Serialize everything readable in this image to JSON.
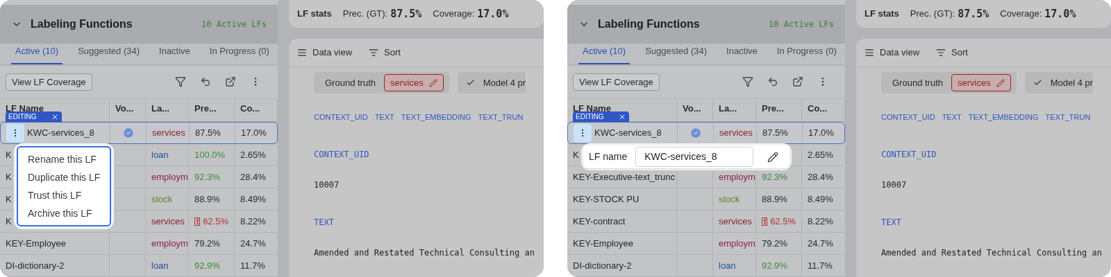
{
  "screens": [
    {
      "lf_panel": {
        "title": "Labeling Functions",
        "count": "10 Active LFs",
        "tabs": [
          {
            "label": "Active (10)",
            "selected": true
          },
          {
            "label": "Suggested (34)",
            "selected": false
          },
          {
            "label": "Inactive",
            "selected": false
          },
          {
            "label": "In Progress (0)",
            "selected": false
          }
        ],
        "coverage_button": "View LF Coverage",
        "columns": [
          "LF Name",
          "Vo...",
          "La...",
          "Pre...",
          "Co..."
        ],
        "editing_badge": "EDITING",
        "rows": [
          {
            "name": "KWC-services_8",
            "selected": true,
            "voted": true,
            "label": "services",
            "color": "#8b1f2e",
            "precision": {
              "text": "87.5%",
              "color": "#2a2a2a"
            },
            "warning": false,
            "coverage": "17.0%"
          },
          {
            "name": "K",
            "selected": false,
            "voted": false,
            "label": "loan",
            "color": "#22509a",
            "precision": {
              "text": "100.0%",
              "color": "#3c8a3c"
            },
            "warning": false,
            "coverage": "2.65%"
          },
          {
            "name": "K",
            "selected": false,
            "voted": false,
            "label": "employm",
            "color": "#8a2148",
            "precision": {
              "text": "92.3%",
              "color": "#3c8a3c"
            },
            "warning": false,
            "coverage": "28.4%"
          },
          {
            "name": "K",
            "selected": false,
            "voted": false,
            "label": "stock",
            "color": "#6f7a2c",
            "precision": {
              "text": "88.9%",
              "color": "#2a2a2a"
            },
            "warning": false,
            "coverage": "8.49%"
          },
          {
            "name": "K",
            "selected": false,
            "voted": false,
            "label": "services",
            "color": "#8b1f2e",
            "precision": {
              "text": "62.5%",
              "color": "#b3312f"
            },
            "warning": true,
            "coverage": "8.22%"
          },
          {
            "name": "KEY-Employee",
            "selected": false,
            "voted": false,
            "label": "employm",
            "color": "#8a2148",
            "precision": {
              "text": "79.2%",
              "color": "#2a2a2a"
            },
            "warning": false,
            "coverage": "24.7%"
          },
          {
            "name": "DI-dictionary-2",
            "selected": false,
            "voted": false,
            "label": "loan",
            "color": "#22509a",
            "precision": {
              "text": "92.9%",
              "color": "#3c8a3c"
            },
            "warning": false,
            "coverage": "11.7%"
          }
        ],
        "overlay": {
          "kind": "menu",
          "items": [
            "Rename this LF",
            "Duplicate this LF",
            "Trust this LF",
            "Archive this LF"
          ]
        }
      },
      "stats": {
        "title": "LF stats",
        "precision_label": "Prec. (GT):",
        "precision": "87.5%",
        "coverage_label": "Coverage:",
        "coverage": "17.0%"
      },
      "data_view": {
        "view_label": "Data view",
        "sort_label": "Sort",
        "ground_truth_label": "Ground truth",
        "ground_truth_value": "services",
        "model_chip": "Model 4 pr",
        "column_tabs": [
          "CONTEXT_UID",
          "TEXT",
          "TEXT_EMBEDDING",
          "TEXT_TRUN"
        ],
        "fields": [
          {
            "name": "CONTEXT_UID",
            "value": "10007"
          },
          {
            "name": "TEXT",
            "value": "Amended and Restated Technical Consulting an"
          }
        ]
      }
    },
    {
      "lf_panel": {
        "title": "Labeling Functions",
        "count": "10 Active LFs",
        "tabs": [
          {
            "label": "Active (10)",
            "selected": true
          },
          {
            "label": "Suggested (34)",
            "selected": false
          },
          {
            "label": "Inactive",
            "selected": false
          },
          {
            "label": "In Progress (0)",
            "selected": false
          }
        ],
        "coverage_button": "View LF Coverage",
        "columns": [
          "LF Name",
          "Vo...",
          "La...",
          "Pre...",
          "Co..."
        ],
        "editing_badge": "EDITING",
        "rows": [
          {
            "name": "KWC-services_8",
            "selected": true,
            "voted": true,
            "label": "services",
            "color": "#8b1f2e",
            "precision": {
              "text": "87.5%",
              "color": "#2a2a2a"
            },
            "warning": false,
            "coverage": "17.0%"
          },
          {
            "name": "K",
            "selected": false,
            "voted": false,
            "warning": false,
            "coverage": "2.65%"
          },
          {
            "name": "KEY-Executive-text_trunc",
            "selected": false,
            "voted": false,
            "label": "employm",
            "color": "#8a2148",
            "precision": {
              "text": "92.3%",
              "color": "#3c8a3c"
            },
            "warning": false,
            "coverage": "28.4%"
          },
          {
            "name": "KEY-STOCK PU",
            "selected": false,
            "voted": false,
            "label": "stock",
            "color": "#6f7a2c",
            "precision": {
              "text": "88.9%",
              "color": "#2a2a2a"
            },
            "warning": false,
            "coverage": "8.49%"
          },
          {
            "name": "KEY-contract",
            "selected": false,
            "voted": false,
            "label": "services",
            "color": "#8b1f2e",
            "precision": {
              "text": "62.5%",
              "color": "#b3312f"
            },
            "warning": true,
            "coverage": "8.22%"
          },
          {
            "name": "KEY-Employee",
            "selected": false,
            "voted": false,
            "label": "employm",
            "color": "#8a2148",
            "precision": {
              "text": "79.2%",
              "color": "#2a2a2a"
            },
            "warning": false,
            "coverage": "24.7%"
          },
          {
            "name": "DI-dictionary-2",
            "selected": false,
            "voted": false,
            "label": "loan",
            "color": "#22509a",
            "precision": {
              "text": "92.9%",
              "color": "#3c8a3c"
            },
            "warning": false,
            "coverage": "11.7%"
          }
        ],
        "overlay": {
          "kind": "rename",
          "label": "LF name",
          "value": "KWC-services_8"
        }
      },
      "stats": {
        "title": "LF stats",
        "precision_label": "Prec. (GT):",
        "precision": "87.5%",
        "coverage_label": "Coverage:",
        "coverage": "17.0%"
      },
      "data_view": {
        "view_label": "Data view",
        "sort_label": "Sort",
        "ground_truth_label": "Ground truth",
        "ground_truth_value": "services",
        "model_chip": "Model 4 pr",
        "column_tabs": [
          "CONTEXT_UID",
          "TEXT",
          "TEXT_EMBEDDING",
          "TEXT_TRUN"
        ],
        "fields": [
          {
            "name": "CONTEXT_UID",
            "value": "10007"
          },
          {
            "name": "TEXT",
            "value": "Amended and Restated Technical Consulting an"
          }
        ]
      }
    }
  ]
}
